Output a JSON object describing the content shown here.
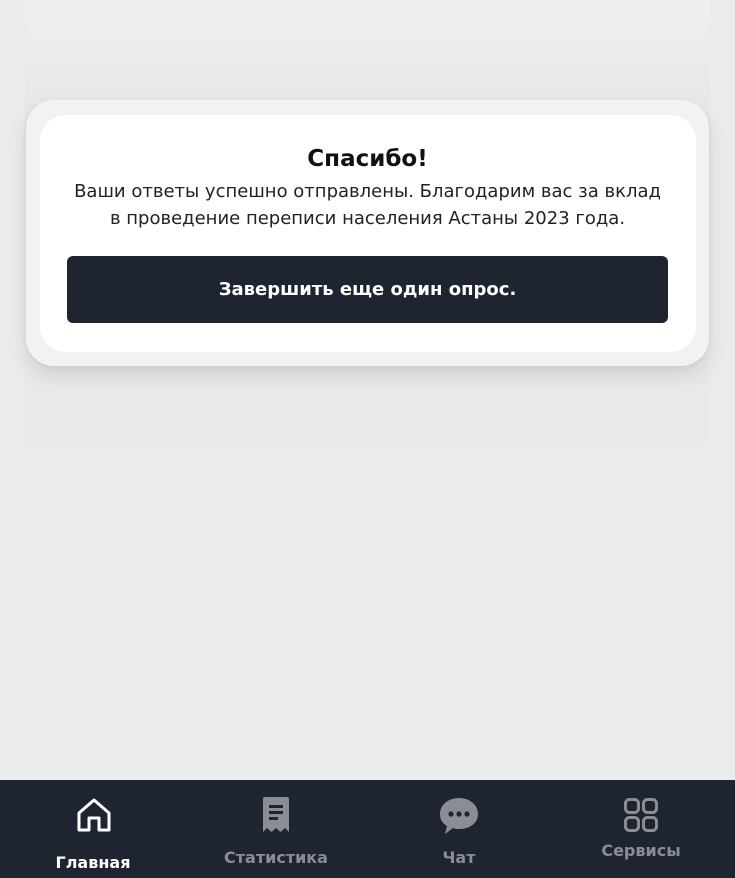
{
  "dialog": {
    "title": "Спасибо!",
    "message": "Ваши ответы успешно отправлены. Благодарим вас за вклад в проведение переписи населения Астаны 2023 года.",
    "button_label": "Завершить еще один опрос."
  },
  "nav": {
    "active_color": "#ffffff",
    "inactive_color": "#8a8d92",
    "background": "#1f2530",
    "items": [
      {
        "label": "Главная",
        "icon": "home-icon",
        "active": true
      },
      {
        "label": "Статистика",
        "icon": "receipt-icon",
        "active": false
      },
      {
        "label": "Чат",
        "icon": "chat-bubble-icon",
        "active": false
      },
      {
        "label": "Сервисы",
        "icon": "grid-icon",
        "active": false
      }
    ]
  }
}
